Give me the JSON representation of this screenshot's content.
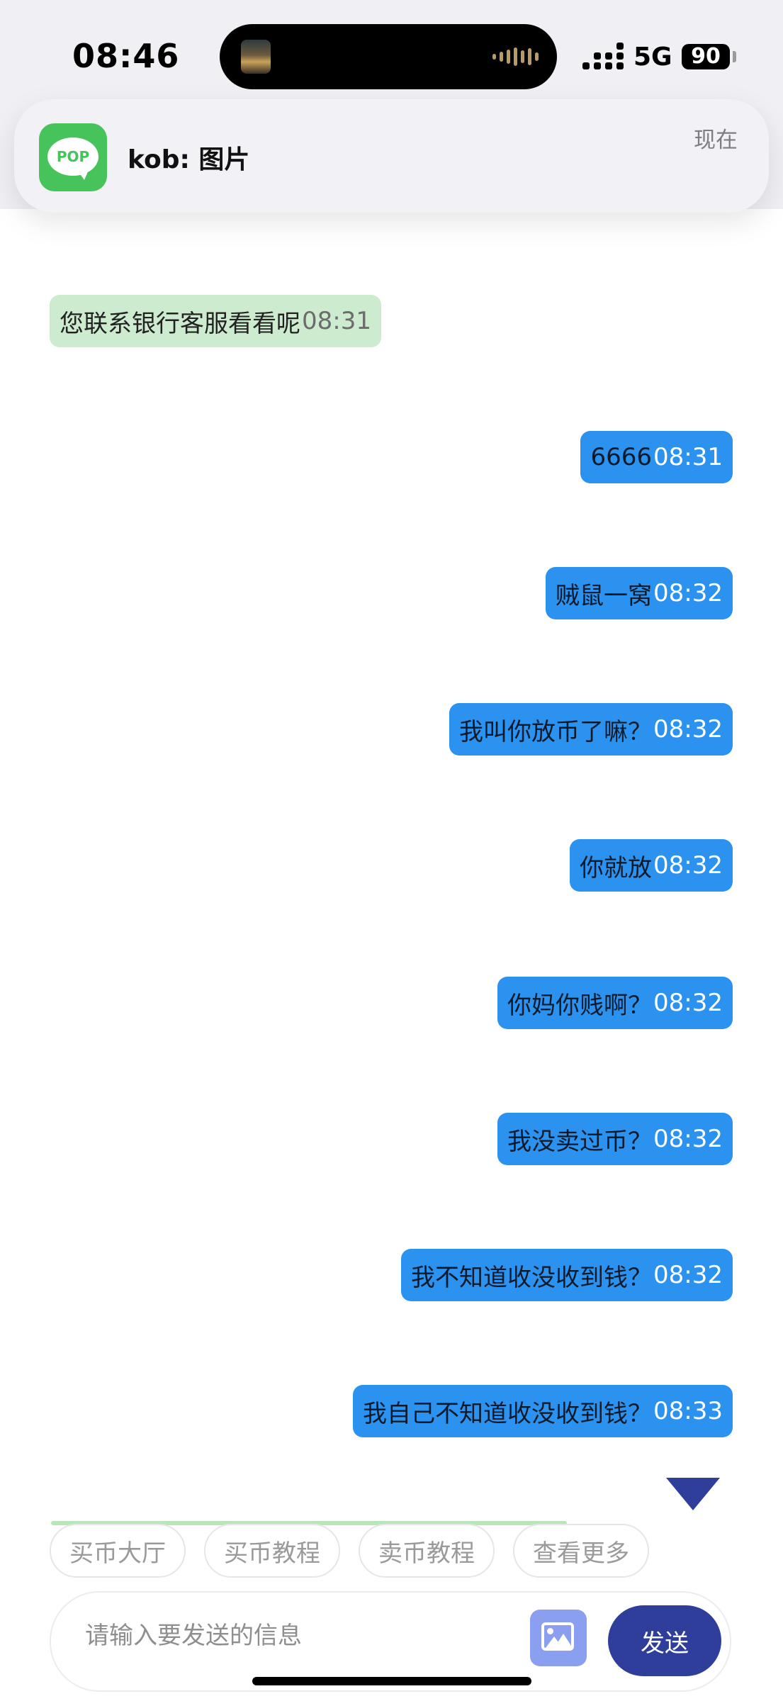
{
  "status_bar": {
    "time": "08:46",
    "network": "5G",
    "battery": "90"
  },
  "notification": {
    "app_icon_text": "POP",
    "title": "kob: 图片",
    "time": "现在"
  },
  "messages": [
    {
      "direction": "in",
      "text": "您联系银行客服看看呢",
      "time": "08:31"
    },
    {
      "direction": "out",
      "text": "6666",
      "time": "08:31"
    },
    {
      "direction": "out",
      "text": "贼鼠一窝",
      "time": "08:32"
    },
    {
      "direction": "out",
      "text": "我叫你放币了嘛？",
      "time": "08:32"
    },
    {
      "direction": "out",
      "text": "你就放",
      "time": "08:32"
    },
    {
      "direction": "out",
      "text": "你妈你贱啊？",
      "time": "08:32"
    },
    {
      "direction": "out",
      "text": "我没卖过币？",
      "time": "08:32"
    },
    {
      "direction": "out",
      "text": "我不知道收没收到钱？",
      "time": "08:32"
    },
    {
      "direction": "out",
      "text": "我自己不知道收没收到钱？",
      "time": "08:33"
    }
  ],
  "quick_actions": [
    "买币大厅",
    "买币教程",
    "卖币教程",
    "查看更多"
  ],
  "composer": {
    "placeholder": "请输入要发送的信息",
    "send_label": "发送"
  },
  "colors": {
    "incoming_bubble": "#cdebce",
    "outgoing_bubble": "#2b93ef",
    "primary_button": "#2e3e9a",
    "notification_icon": "#46c35a"
  }
}
